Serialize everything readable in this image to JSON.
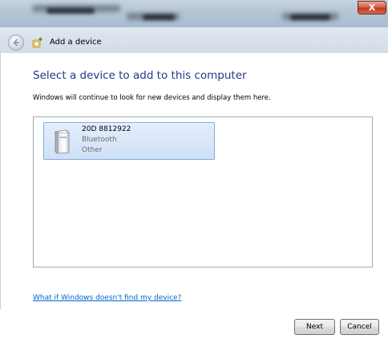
{
  "window": {
    "close_label": "X"
  },
  "nav": {
    "title": "Add a device"
  },
  "main": {
    "heading": "Select a device to add to this computer",
    "description": "Windows will continue to look for new devices and display them here.",
    "devices": [
      {
        "name": "20D 8812922",
        "type": "Bluetooth",
        "category": "Other",
        "selected": true
      }
    ],
    "help_link": "What if Windows doesn't find my device?"
  },
  "footer": {
    "next_label": "Next",
    "cancel_label": "Cancel"
  },
  "colors": {
    "heading": "#1e3a8a",
    "link": "#0066cc",
    "selection": "#cfe0f6"
  },
  "icons": {
    "back": "back-arrow-icon",
    "wizard": "add-device-icon",
    "device": "generic-device-icon"
  }
}
